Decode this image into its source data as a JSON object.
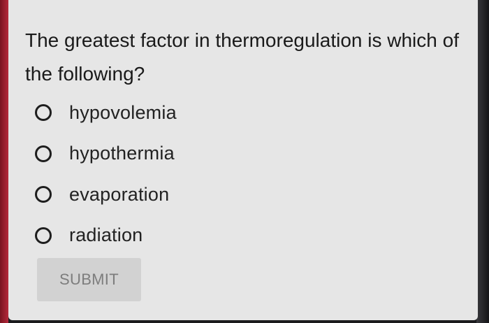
{
  "question": {
    "text": "The greatest factor in thermoregulation is which of the following?"
  },
  "options": [
    {
      "label": "hypovolemia",
      "selected": false
    },
    {
      "label": "hypothermia",
      "selected": false
    },
    {
      "label": "evaporation",
      "selected": false
    },
    {
      "label": "radiation",
      "selected": false
    }
  ],
  "submit": {
    "label": "SUBMIT",
    "enabled": false
  }
}
